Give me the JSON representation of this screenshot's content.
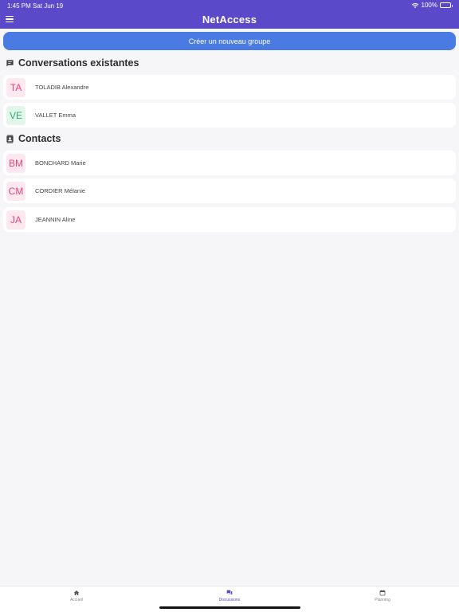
{
  "status_bar": {
    "time": "1:45 PM",
    "date": "Sat Jun 19",
    "battery": "100%"
  },
  "header": {
    "title": "NetAccess"
  },
  "create_group_label": "Créer un nouveau groupe",
  "conversations": {
    "title": "Conversations existantes",
    "items": [
      {
        "initials": "TA",
        "name": "TOLADIB Alexandre",
        "color": "pink"
      },
      {
        "initials": "VE",
        "name": "VALLET Emma",
        "color": "green"
      }
    ]
  },
  "contacts": {
    "title": "Contacts",
    "items": [
      {
        "initials": "BM",
        "name": "BONCHARD Marie",
        "color": "pink"
      },
      {
        "initials": "CM",
        "name": "CORDIER Mélanie",
        "color": "pink"
      },
      {
        "initials": "JA",
        "name": "JEANNIN Aline",
        "color": "pink"
      }
    ]
  },
  "tabs": [
    {
      "label": "Accueil",
      "icon": "home-icon",
      "active": false
    },
    {
      "label": "Discussions",
      "icon": "chat-icon",
      "active": true
    },
    {
      "label": "Planning",
      "icon": "calendar-icon",
      "active": false
    }
  ],
  "colors": {
    "header": "#5a49c9",
    "button": "#4a7be3",
    "pink_avatar": "#e0447a",
    "green_avatar": "#2bb06b"
  }
}
